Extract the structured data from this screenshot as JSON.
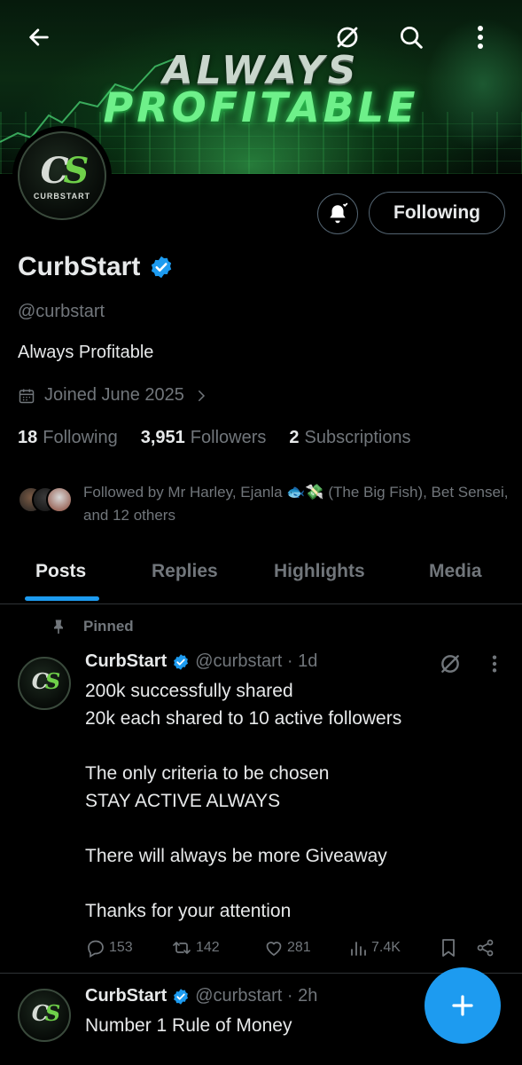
{
  "banner": {
    "line1": "ALWAYS",
    "line2": "PROFITABLE"
  },
  "profile": {
    "display_name": "CurbStart",
    "handle": "@curbstart",
    "bio": "Always Profitable",
    "joined": "Joined June 2025",
    "follow_button_label": "Following",
    "avatar_initials": "CS",
    "avatar_wordmark": "CURBSTART"
  },
  "stats": {
    "following_count": "18",
    "following_label": "Following",
    "followers_count": "3,951",
    "followers_label": "Followers",
    "subscriptions_count": "2",
    "subscriptions_label": "Subscriptions"
  },
  "followed_by": {
    "text": "Followed by Mr Harley, Ejanla 🐟💸 (The Big Fish), Bet Sensei, and 12 others"
  },
  "tabs": [
    {
      "label": "Posts"
    },
    {
      "label": "Replies"
    },
    {
      "label": "Highlights"
    },
    {
      "label": "Media"
    }
  ],
  "posts": [
    {
      "pinned_label": "Pinned",
      "name": "CurbStart",
      "meta": "@curbstart · 1d",
      "text": "200k successfully shared\n20k each shared to 10 active followers\n\nThe only criteria to be chosen\nSTAY ACTIVE ALWAYS\n\nThere will always be more Giveaway\n\nThanks for your attention",
      "replies": "153",
      "reposts": "142",
      "likes": "281",
      "views": "7.4K"
    },
    {
      "name": "CurbStart",
      "meta": "@curbstart · 2h",
      "text": "Number 1 Rule of Money"
    }
  ],
  "colors": {
    "accent": "#1d9bf0",
    "background": "#000000",
    "text_primary": "#e7e9ea",
    "text_secondary": "#71767b",
    "divider": "#2f3336"
  },
  "icons": [
    "back-arrow-icon",
    "grok-icon",
    "search-icon",
    "more-vertical-icon",
    "bell-icon",
    "verified-badge-icon",
    "calendar-icon",
    "chevron-right-icon",
    "pin-icon",
    "reply-icon",
    "repost-icon",
    "like-icon",
    "views-icon",
    "bookmark-icon",
    "share-icon",
    "compose-plus-icon"
  ]
}
